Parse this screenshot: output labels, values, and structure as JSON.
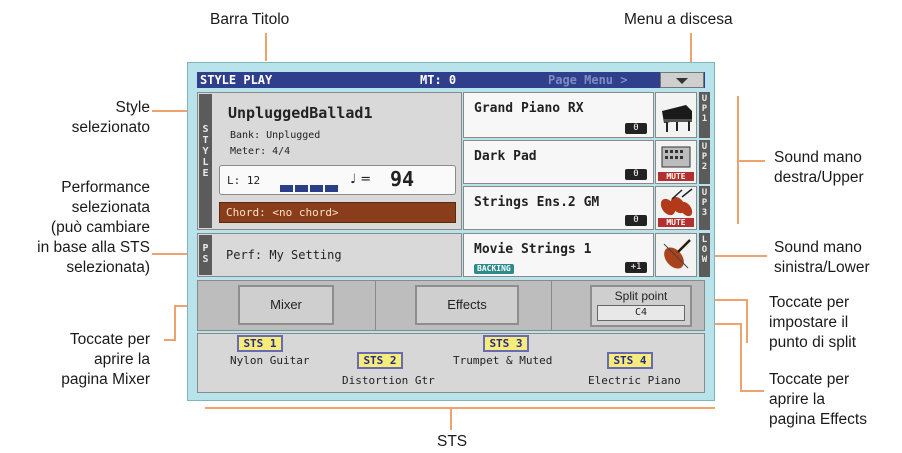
{
  "annotations": {
    "barra_titolo": "Barra Titolo",
    "menu_discesa": "Menu a discesa",
    "style_sel": [
      "Style",
      "selezionato"
    ],
    "performance": [
      "Performance",
      "selezionata",
      "(può cambiare",
      "in base alla STS",
      "selezionata)"
    ],
    "mixer": [
      "Toccate per",
      "aprire la",
      "pagina Mixer"
    ],
    "upper": [
      "Sound mano",
      "destra/Upper"
    ],
    "lower": [
      "Sound mano",
      "sinistra/Lower"
    ],
    "split": [
      "Toccate per",
      "impostare il",
      "punto di split"
    ],
    "effects": [
      "Toccate per",
      "aprire la",
      "pagina Effects"
    ],
    "sts": "STS"
  },
  "title_bar": {
    "title": "STYLE PLAY",
    "mt": "MT: 0",
    "page_menu": "Page Menu >"
  },
  "style": {
    "tab": [
      "S",
      "T",
      "Y",
      "L",
      "E"
    ],
    "name": "UnpluggedBallad1",
    "bank": "Bank:  Unplugged",
    "meter": "Meter:  4/4",
    "length": "L: 12",
    "tempo_sym": "♩ =",
    "tempo": "94",
    "chord": "Chord: <no chord>"
  },
  "performance": {
    "tab": [
      "P",
      "S"
    ],
    "text": "Perf:  My Setting"
  },
  "sounds": [
    {
      "name": "Grand Piano RX",
      "octave": "0",
      "label": [
        "U",
        "P",
        "1"
      ]
    },
    {
      "name": "Dark Pad",
      "octave": "0",
      "label": [
        "U",
        "P",
        "2"
      ],
      "mute": "MUTE"
    },
    {
      "name": "Strings Ens.2 GM",
      "octave": "0",
      "label": [
        "U",
        "P",
        "3"
      ],
      "mute": "MUTE"
    },
    {
      "name": "Movie Strings 1",
      "octave": "+1",
      "label": [
        "L",
        "O",
        "W"
      ],
      "badge": "BACKING"
    }
  ],
  "buttons": {
    "mixer": "Mixer",
    "effects": "Effects",
    "split_label": "Split point",
    "split_value": "C4"
  },
  "sts": [
    {
      "label": "STS 1",
      "name": "Nylon Guitar"
    },
    {
      "label": "STS 2",
      "name": "Distortion Gtr"
    },
    {
      "label": "STS 3",
      "name": "Trumpet & Muted"
    },
    {
      "label": "STS 4",
      "name": "Electric Piano"
    }
  ],
  "colors": {
    "title_bar": "#2f3f8c",
    "screen_bg": "#b9e3ea",
    "chord_bg": "#8a3d1a",
    "sts_button": "#f6ec7a",
    "callout_line": "#f0a26e"
  }
}
